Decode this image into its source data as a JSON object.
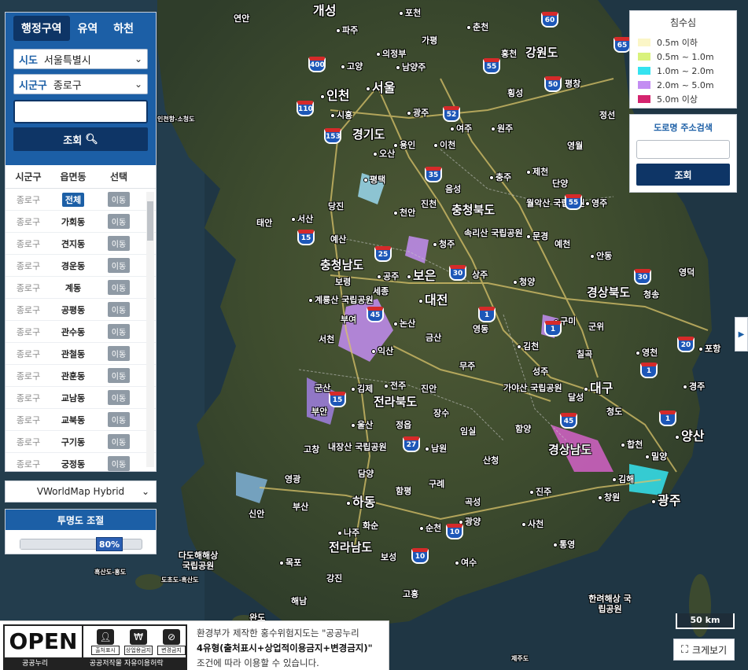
{
  "tabs": [
    "행정구역",
    "유역",
    "하천"
  ],
  "filters": {
    "sido_label": "시도",
    "sido_value": "서울특별시",
    "sigungu_label": "시군구",
    "sigungu_value": "종로구",
    "search_value": "",
    "search_button": "조회"
  },
  "list": {
    "headers": [
      "시군구",
      "읍면동",
      "선택"
    ],
    "rows": [
      {
        "sigungu": "종로구",
        "dong": "전체",
        "action": "이동"
      },
      {
        "sigungu": "종로구",
        "dong": "가회동",
        "action": "이동"
      },
      {
        "sigungu": "종로구",
        "dong": "견지동",
        "action": "이동"
      },
      {
        "sigungu": "종로구",
        "dong": "경운동",
        "action": "이동"
      },
      {
        "sigungu": "종로구",
        "dong": "계동",
        "action": "이동"
      },
      {
        "sigungu": "종로구",
        "dong": "공평동",
        "action": "이동"
      },
      {
        "sigungu": "종로구",
        "dong": "관수동",
        "action": "이동"
      },
      {
        "sigungu": "종로구",
        "dong": "관철동",
        "action": "이동"
      },
      {
        "sigungu": "종로구",
        "dong": "관훈동",
        "action": "이동"
      },
      {
        "sigungu": "종로구",
        "dong": "교남동",
        "action": "이동"
      },
      {
        "sigungu": "종로구",
        "dong": "교북동",
        "action": "이동"
      },
      {
        "sigungu": "종로구",
        "dong": "구기동",
        "action": "이동"
      },
      {
        "sigungu": "종로구",
        "dong": "궁정동",
        "action": "이동"
      }
    ]
  },
  "basemap": "VWorldMap Hybrid",
  "opacity": {
    "title": "투명도 조절",
    "value_label": "80%",
    "value": 0.8
  },
  "legend": {
    "title": "침수심",
    "items": [
      {
        "label": "0.5m 이하",
        "color": "#fbf6c7"
      },
      {
        "label": "0.5m ~ 1.0m",
        "color": "#d9f27c"
      },
      {
        "label": "1.0m ~ 2.0m",
        "color": "#35e3f0"
      },
      {
        "label": "2.0m ~ 5.0m",
        "color": "#c38df2"
      },
      {
        "label": "5.0m 이상",
        "color": "#d4246e"
      }
    ]
  },
  "address_search": {
    "title": "도로명 주소검색",
    "value": "",
    "button": "조회"
  },
  "scale": "50 km",
  "enlarge_button": "크게보기",
  "license": {
    "open_word": "OPEN",
    "icon_labels": [
      "출처표시",
      "상업용금지",
      "변경금지"
    ],
    "bar_left": "공공누리",
    "bar_right": "공공저작물 자유이용허락",
    "text_line1": "환경부가 제작한 홍수위험지도는 \"공공누리",
    "text_line2": "4유형(출처표시+상업적이용금지+변경금지)\"",
    "text_line3": "조건에 따라 이용할 수 있습니다."
  },
  "map_labels": {
    "regions": [
      "경기도",
      "강원도",
      "충청북도",
      "충청남도",
      "경상북도",
      "전라북도",
      "경상남도",
      "전라남도"
    ],
    "cities": [
      "개성",
      "연안",
      "파주",
      "포천",
      "춘천",
      "가평",
      "의정부",
      "남양주",
      "고양",
      "서울",
      "홍천",
      "평창",
      "인천",
      "횡성",
      "광주",
      "시흥",
      "여주",
      "원주",
      "정선",
      "용인",
      "이천",
      "오산",
      "영월",
      "제천",
      "충주",
      "단양",
      "평택",
      "음성",
      "태안",
      "서산",
      "천안",
      "진천",
      "영주",
      "월악산 국립공원",
      "당진",
      "예산",
      "청주",
      "속리산 국립공원",
      "문경",
      "예천",
      "안동",
      "영덕",
      "세종",
      "공주",
      "보은",
      "상주",
      "청양",
      "보령",
      "계룡산 국립공원",
      "대전",
      "청송",
      "구미",
      "부여",
      "논산",
      "영동",
      "군위",
      "김천",
      "칠곡",
      "영천",
      "포항",
      "서천",
      "익산",
      "금산",
      "무주",
      "성주",
      "대구",
      "경주",
      "군산",
      "김제",
      "전주",
      "진안",
      "가야산 국립공원",
      "달성",
      "부안",
      "장수",
      "청도",
      "울산",
      "정읍",
      "임실",
      "함양",
      "합천",
      "밀양",
      "양산",
      "고창",
      "내장산 국립공원",
      "남원",
      "산청",
      "김해",
      "영광",
      "담양",
      "구례",
      "진주",
      "창원",
      "부산",
      "함평",
      "광주",
      "곡성",
      "하동",
      "신안",
      "화순",
      "광양",
      "사천",
      "나주",
      "순천",
      "통영",
      "다도해해상 국립공원",
      "목포",
      "보성",
      "여수",
      "강진",
      "해남",
      "고흥",
      "한려해상 국립공원",
      "완도"
    ],
    "sea_labels": [
      "인천항-소청도",
      "흑산도-홍도",
      "도초도-흑산도",
      "제주도"
    ],
    "highways": [
      "60",
      "65",
      "400",
      "55",
      "50",
      "110",
      "52",
      "153",
      "35",
      "55",
      "15",
      "25",
      "30",
      "30",
      "1",
      "1",
      "20",
      "1",
      "45",
      "15",
      "27",
      "45",
      "1",
      "10",
      "10"
    ]
  }
}
